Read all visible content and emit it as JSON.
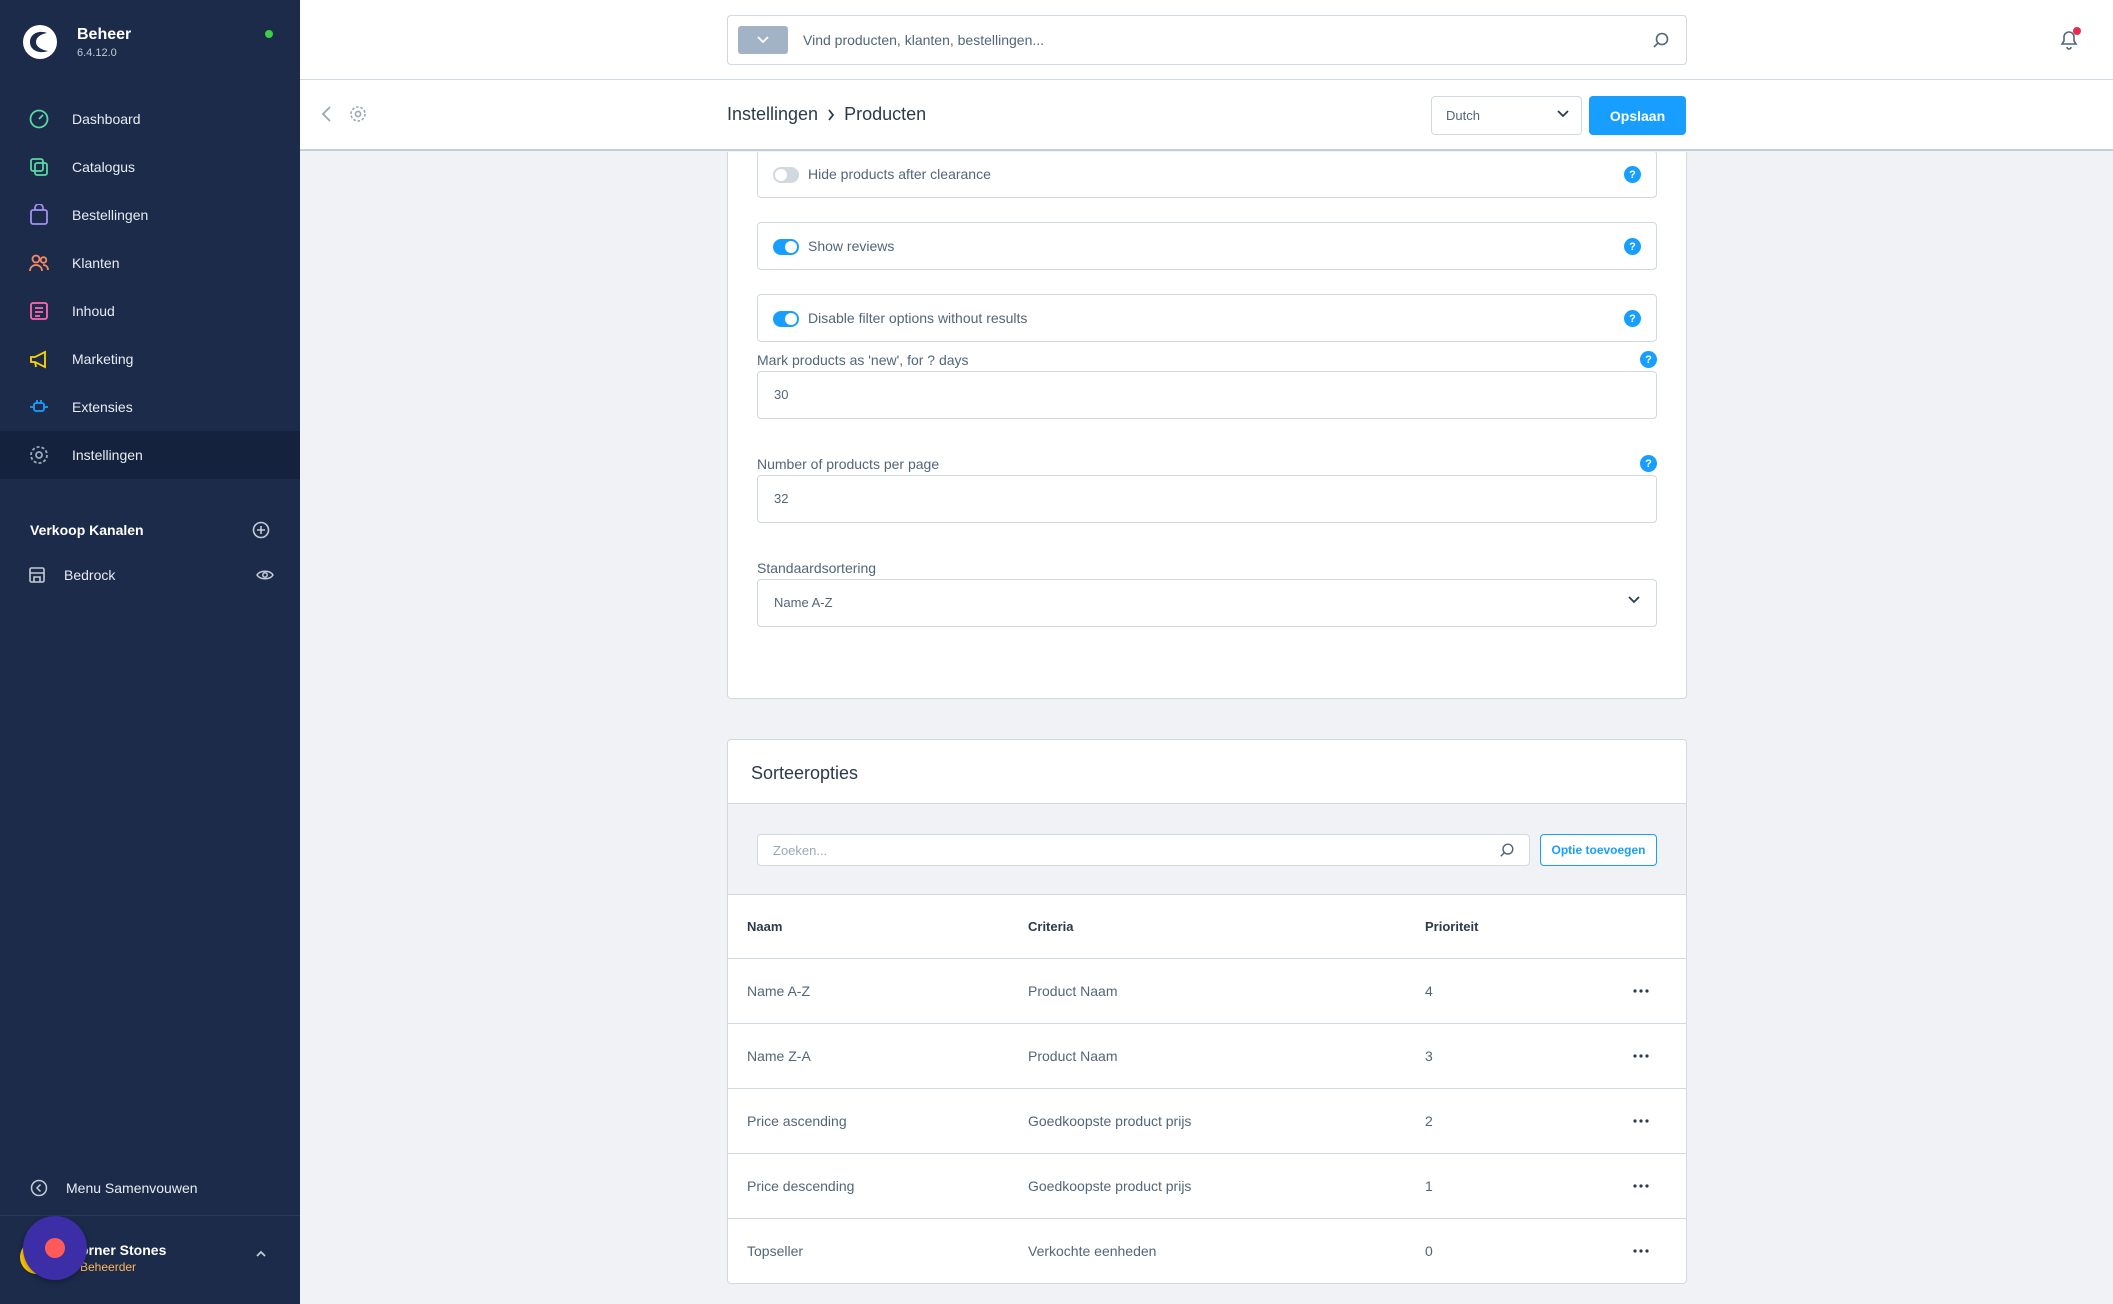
{
  "app": {
    "name": "Beheer",
    "version": "6.4.12.0",
    "colors": {
      "sidebar": "#1c2b4a",
      "accent": "#189eff",
      "status_online": "#37d046"
    }
  },
  "sidebar": {
    "items": [
      {
        "label": "Dashboard",
        "icon": "dashboard-icon",
        "color": "#57d9a3"
      },
      {
        "label": "Catalogus",
        "icon": "catalog-icon",
        "color": "#57d9a3"
      },
      {
        "label": "Bestellingen",
        "icon": "shopping-bag-icon",
        "color": "#a092f0"
      },
      {
        "label": "Klanten",
        "icon": "users-icon",
        "color": "#f88962"
      },
      {
        "label": "Inhoud",
        "icon": "content-icon",
        "color": "#ff68b4"
      },
      {
        "label": "Marketing",
        "icon": "megaphone-icon",
        "color": "#ffd700"
      },
      {
        "label": "Extensies",
        "icon": "plug-icon",
        "color": "#189eff"
      },
      {
        "label": "Instellingen",
        "icon": "gear-icon",
        "color": "#9aa8b5",
        "active": true
      }
    ],
    "sales_channels_label": "Verkoop Kanalen",
    "channels": [
      {
        "label": "Bedrock",
        "icon": "storefront-icon"
      }
    ],
    "collapse_label": "Menu Samenvouwen",
    "user": {
      "name": "Corner Stones",
      "name_visible": "orner Stones",
      "role": "Beheerder"
    }
  },
  "topbar": {
    "search_placeholder": "Vind producten, klanten, bestellingen..."
  },
  "header": {
    "breadcrumb": [
      "Instellingen",
      "Producten"
    ],
    "language": "Dutch",
    "save_label": "Opslaan"
  },
  "settings": {
    "switches": [
      {
        "label": "Hide products after clearance",
        "on": false
      },
      {
        "label": "Show reviews",
        "on": true
      },
      {
        "label": "Disable filter options without results",
        "on": true
      }
    ],
    "new_days": {
      "label": "Mark products as 'new', for ? days",
      "value": "30"
    },
    "per_page": {
      "label": "Number of products per page",
      "value": "32"
    },
    "default_sorting": {
      "label": "Standaardsortering",
      "value": "Name A-Z"
    },
    "help_glyph": "?"
  },
  "sorting": {
    "title": "Sorteeropties",
    "search_placeholder": "Zoeken...",
    "add_label": "Optie toevoegen",
    "columns": [
      "Naam",
      "Criteria",
      "Prioriteit"
    ],
    "rows": [
      {
        "name": "Name A-Z",
        "criteria": "Product Naam",
        "priority": "4"
      },
      {
        "name": "Name Z-A",
        "criteria": "Product Naam",
        "priority": "3"
      },
      {
        "name": "Price ascending",
        "criteria": "Goedkoopste product prijs",
        "priority": "2"
      },
      {
        "name": "Price descending",
        "criteria": "Goedkoopste product prijs",
        "priority": "1"
      },
      {
        "name": "Topseller",
        "criteria": "Verkochte eenheden",
        "priority": "0"
      }
    ]
  }
}
